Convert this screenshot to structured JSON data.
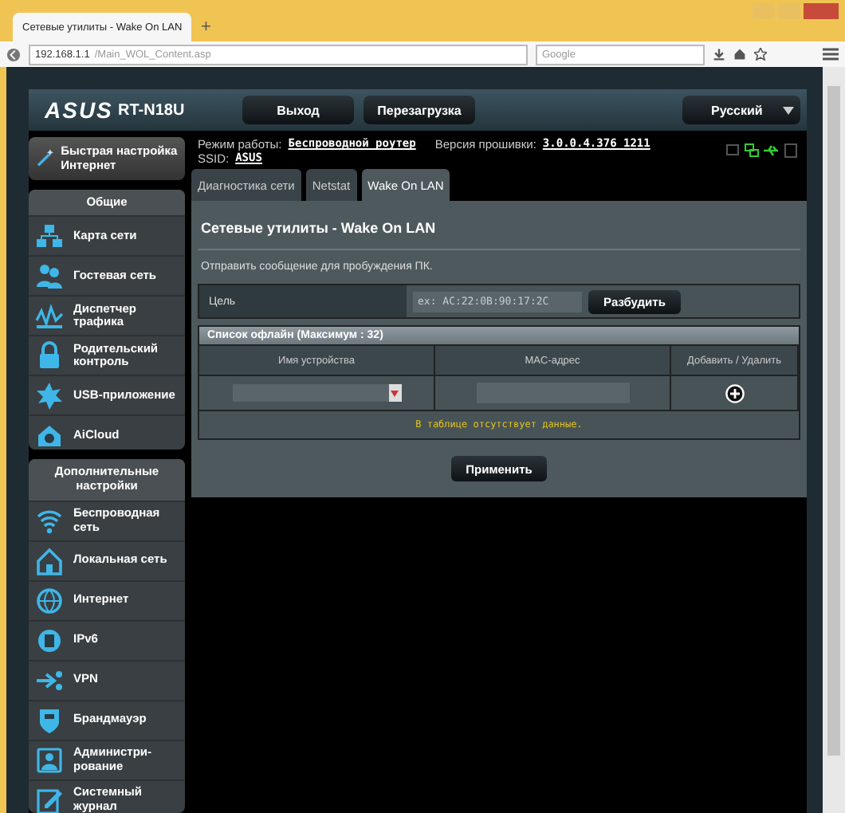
{
  "browser": {
    "tab_title": "Сетевые утилиты - Wake On LAN",
    "new_tab": "+",
    "url_host": "192.168.1.1",
    "url_path": "/Main_WOL_Content.asp",
    "search_placeholder": "Google"
  },
  "header": {
    "brand": "ASUS",
    "model": "RT-N18U",
    "buttons": [
      "Выход",
      "Перезагрузка"
    ],
    "language": "Русский"
  },
  "status": {
    "mode_label": "Режим работы:",
    "mode_value": "Беспроводной роутер",
    "firmware_label": "Версия прошивки:",
    "firmware_value": "3.0.0.4.376_1211",
    "ssid_label": "SSID:",
    "ssid_value": "ASUS"
  },
  "sidebar": {
    "quick_setup": "Быстрая настройка Интернет",
    "sections": [
      {
        "title": "Общие",
        "items": [
          {
            "label": "Карта сети"
          },
          {
            "label": "Гостевая сеть"
          },
          {
            "label": "Диспетчер трафика"
          },
          {
            "label": "Родительский контроль"
          },
          {
            "label": "USB-приложение"
          },
          {
            "label": "AiCloud"
          }
        ]
      },
      {
        "title": "Дополнительные настройки",
        "items": [
          {
            "label": "Беспроводная сеть"
          },
          {
            "label": "Локальная сеть"
          },
          {
            "label": "Интернет"
          },
          {
            "label": "IPv6"
          },
          {
            "label": "VPN"
          },
          {
            "label": "Брандмауэр"
          },
          {
            "label": "Администри-рование"
          },
          {
            "label": "Системный журнал"
          }
        ]
      }
    ]
  },
  "tabs": [
    {
      "label": "Диагностика сети",
      "selected": false
    },
    {
      "label": "Netstat",
      "selected": false
    },
    {
      "label": "Wake On LAN",
      "selected": true
    }
  ],
  "panel": {
    "title": "Сетевые утилиты - Wake On LAN",
    "description": "Отправить сообщение для пробуждения ПК.",
    "target": {
      "label": "Цель",
      "placeholder": "ex: AC:22:0B:90:17:2C",
      "button": "Разбудить"
    },
    "offline_list": {
      "title": "Список офлайн (Максимум : 32)",
      "columns": [
        "Имя устройства",
        "MAC-адрес",
        "Добавить / Удалить"
      ],
      "empty_message": "В таблице отсутствует данные."
    },
    "apply_button": "Применить"
  }
}
